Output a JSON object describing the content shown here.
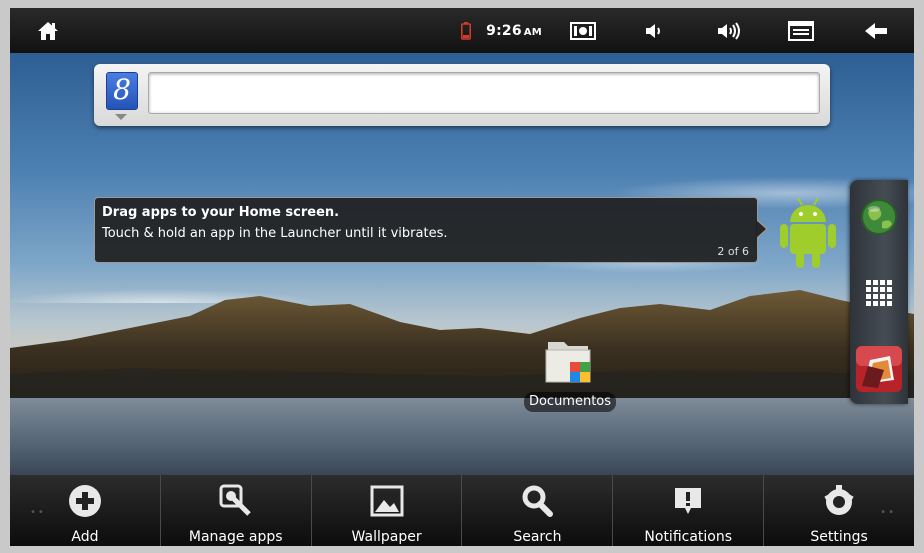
{
  "status_bar": {
    "time": "9:26",
    "ampm": "AM",
    "icons": [
      "home-icon",
      "battery-icon",
      "screenshot-icon",
      "volume-down-icon",
      "volume-up-icon",
      "menu-icon",
      "back-icon"
    ],
    "battery_color": "#d23b2a"
  },
  "search": {
    "engine_logo": "8",
    "query": "",
    "placeholder": ""
  },
  "tooltip": {
    "title": "Drag apps to your Home screen.",
    "body": "Touch & hold an app in the Launcher until it vibrates.",
    "counter": "2 of 6"
  },
  "dock": {
    "items": [
      "browser-globe-icon",
      "app-launcher-grid-icon",
      "gallery-app-icon"
    ]
  },
  "desktop": {
    "shortcut_label": "Documentos"
  },
  "menu": {
    "items": [
      {
        "label": "Add",
        "icon": "add-icon"
      },
      {
        "label": "Manage apps",
        "icon": "manage-apps-icon"
      },
      {
        "label": "Wallpaper",
        "icon": "wallpaper-icon"
      },
      {
        "label": "Search",
        "icon": "search-icon"
      },
      {
        "label": "Notifications",
        "icon": "notifications-icon"
      },
      {
        "label": "Settings",
        "icon": "settings-icon"
      }
    ]
  },
  "colors": {
    "android_green": "#9fcd2c",
    "search_button_blue": "#2e63c9"
  }
}
